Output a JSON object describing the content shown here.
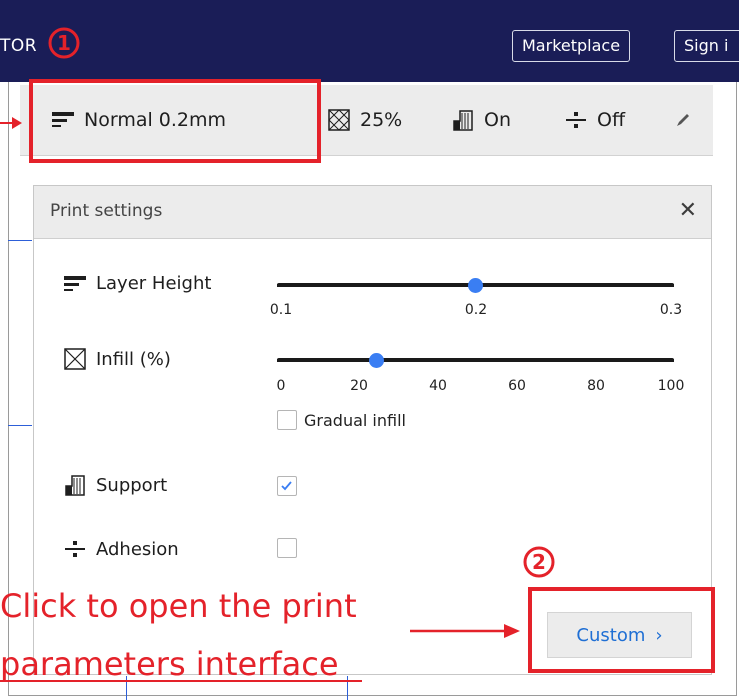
{
  "window": {
    "brand_partial": "TOR",
    "marketplace_label": "Marketplace",
    "signin_label": "Sign i"
  },
  "toolbar": {
    "profile_label": "Normal 0.2mm",
    "infill_label": "25%",
    "support_label": "On",
    "adhesion_label": "Off"
  },
  "print_settings": {
    "title": "Print settings",
    "close_glyph": "✕",
    "layer_height": {
      "label": "Layer Height",
      "ticks": [
        "0.1",
        "0.2",
        "0.3"
      ],
      "value": 0.2,
      "range": [
        0.1,
        0.3
      ]
    },
    "infill": {
      "label": "Infill (%)",
      "ticks": [
        "0",
        "20",
        "40",
        "60",
        "80",
        "100"
      ],
      "value": 25,
      "range": [
        0,
        100
      ],
      "gradual_label": "Gradual infill",
      "gradual_checked": false
    },
    "support": {
      "label": "Support",
      "checked": true
    },
    "adhesion": {
      "label": "Adhesion",
      "checked": false
    },
    "custom_button_label": "Custom"
  },
  "annotations": {
    "marker_1": "1",
    "marker_2": "2",
    "text_line_1": "Click to open the print",
    "text_line_2": "parameters interface",
    "color": "#e4222a"
  },
  "colors": {
    "header_bg": "#1a1d57",
    "accent_blue": "#3a7ef3",
    "link_blue": "#1f6fd4"
  }
}
